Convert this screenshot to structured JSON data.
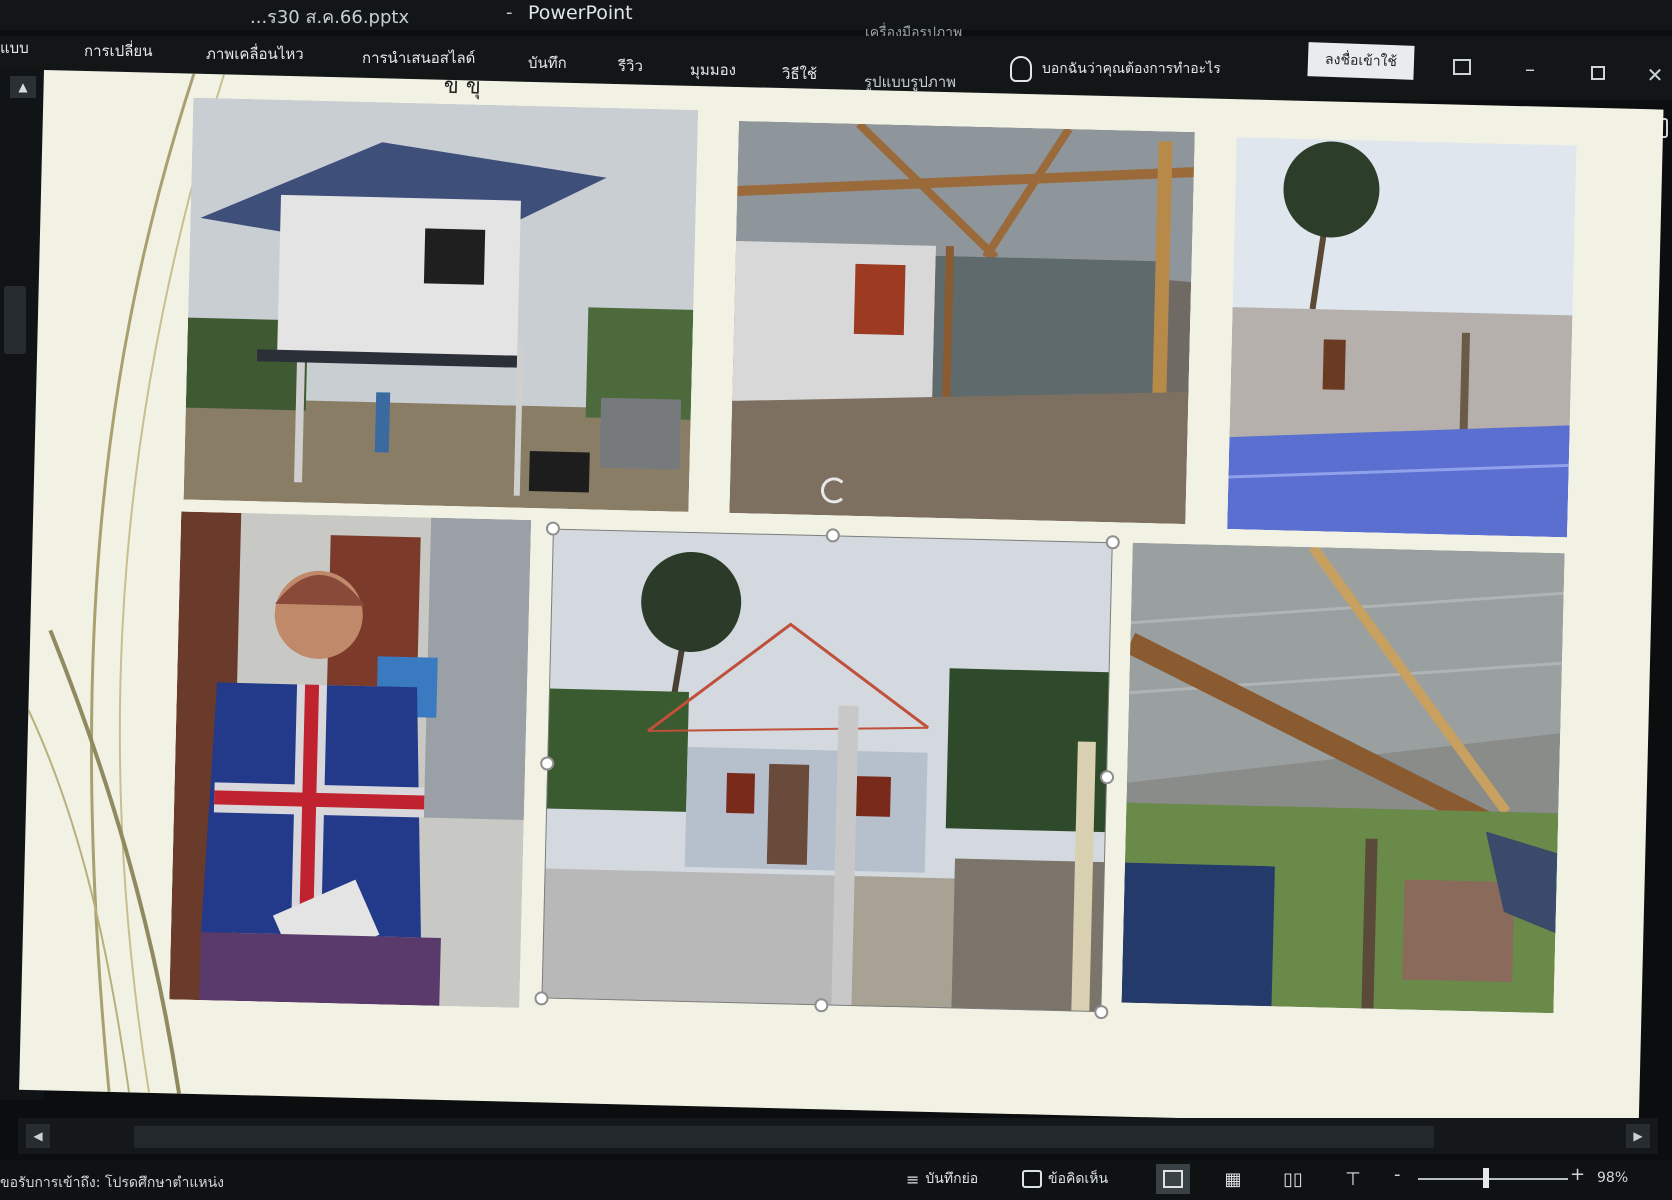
{
  "window": {
    "document_title": "...ร30 ส.ค.66.pptx",
    "separator": "-",
    "app_name": "PowerPoint",
    "contextual_group": "เครื่องมือรูปภาพ",
    "sign_in": "ลงชื่อเข้าใช้"
  },
  "ribbon": {
    "tabs": [
      {
        "label": "แบบ"
      },
      {
        "label": "การเปลี่ยน"
      },
      {
        "label": "ภาพเคลื่อนไหว"
      },
      {
        "label": "การนำเสนอสไลด์"
      },
      {
        "label": "บันทึก"
      },
      {
        "label": "รีวิว"
      },
      {
        "label": "มุมมอง"
      },
      {
        "label": "วิธีใช้"
      },
      {
        "label": "รูปแบบรูปภาพ"
      }
    ],
    "tell_me": "บอกฉันว่าคุณต้องการทำอะไร"
  },
  "slide": {
    "heading_fragment": "ข ขุ",
    "photos": [
      {
        "subject": "two-storey wooden house on stilts"
      },
      {
        "subject": "interior with corrugated metal roof"
      },
      {
        "subject": "concrete walls with palm tree and tiled floor"
      },
      {
        "subject": "elderly woman seated with document"
      },
      {
        "subject": "small concrete house under construction (selected)"
      },
      {
        "subject": "damaged roof beam close-up"
      }
    ]
  },
  "statusbar": {
    "left_text": "ขอรับการเข้าถึง: โปรดศึกษาตำแหน่ง",
    "notes": "บันทึกย่อ",
    "comments": "ข้อคิดเห็น",
    "zoom_minus": "-",
    "zoom_plus": "+",
    "zoom_level": "98%",
    "zoom_value": 0.45
  },
  "colors": {
    "chrome": "#121617",
    "slide_bg": "#f2f2e4",
    "accent_line": "#c0503a"
  }
}
